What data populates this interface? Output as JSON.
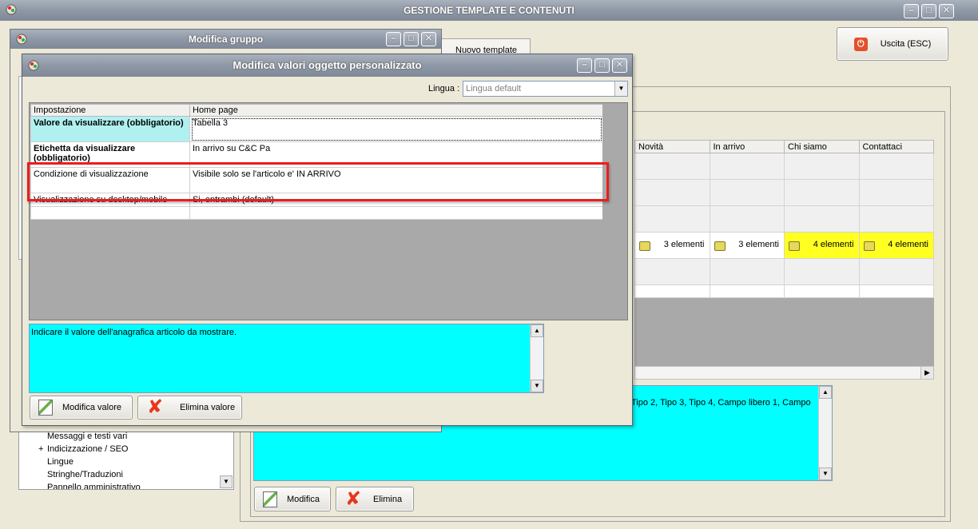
{
  "main_window": {
    "title": "GESTIONE TEMPLATE E CONTENUTI",
    "exit_button": "Uscita (ESC)",
    "nuovo_template_button": "Nuovo template",
    "grid": {
      "columns": [
        "Novità",
        "In arrivo",
        "Chi siamo",
        "Contattaci"
      ],
      "counts_row": [
        "3 elementi",
        "3 elementi",
        "4 elementi",
        "4 elementi"
      ],
      "highlight_color": "#ffff22"
    },
    "description_text": "Tipo 2, Tipo 3, Tipo 4, Campo libero 1, Campo",
    "modifica_button": "Modifica",
    "elimina_button": "Elimina",
    "tree_items": [
      {
        "label": "Messaggi e testi vari",
        "expandable": false
      },
      {
        "label": "Indicizzazione / SEO",
        "expandable": true
      },
      {
        "label": "Lingue",
        "expandable": false
      },
      {
        "label": "Stringhe/Traduzioni",
        "expandable": false
      },
      {
        "label": "Pannello amministrativo",
        "expandable": false
      }
    ]
  },
  "group_window": {
    "title": "Modifica gruppo"
  },
  "values_window": {
    "title": "Modifica valori oggetto personalizzato",
    "language_label": "Lingua :",
    "language_value": "Lingua default",
    "table": {
      "headers": [
        "Impostazione",
        "Home page"
      ],
      "rows": [
        {
          "name": "Valore da visualizzare (obbligatorio)",
          "value": "Tabella 3"
        },
        {
          "name": "Etichetta da visualizzare (obbligatorio)",
          "value": "In arrivo su C&C Pa"
        },
        {
          "name": "Condizione di visualizzazione",
          "value": "Visibile solo se l'articolo e' IN ARRIVO"
        },
        {
          "name": "Visualizzazione su desktop/mobile",
          "value": "Si, entrambi (default)"
        }
      ]
    },
    "description": "Indicare il valore dell'anagrafica articolo da mostrare.",
    "modifica_valore_button": "Modifica valore",
    "elimina_valore_button": "Elimina valore"
  },
  "colors": {
    "description_bg": "#00ffff",
    "highlight_border": "#ee1c1c",
    "selected_cell_bg": "#b0f0f0"
  }
}
